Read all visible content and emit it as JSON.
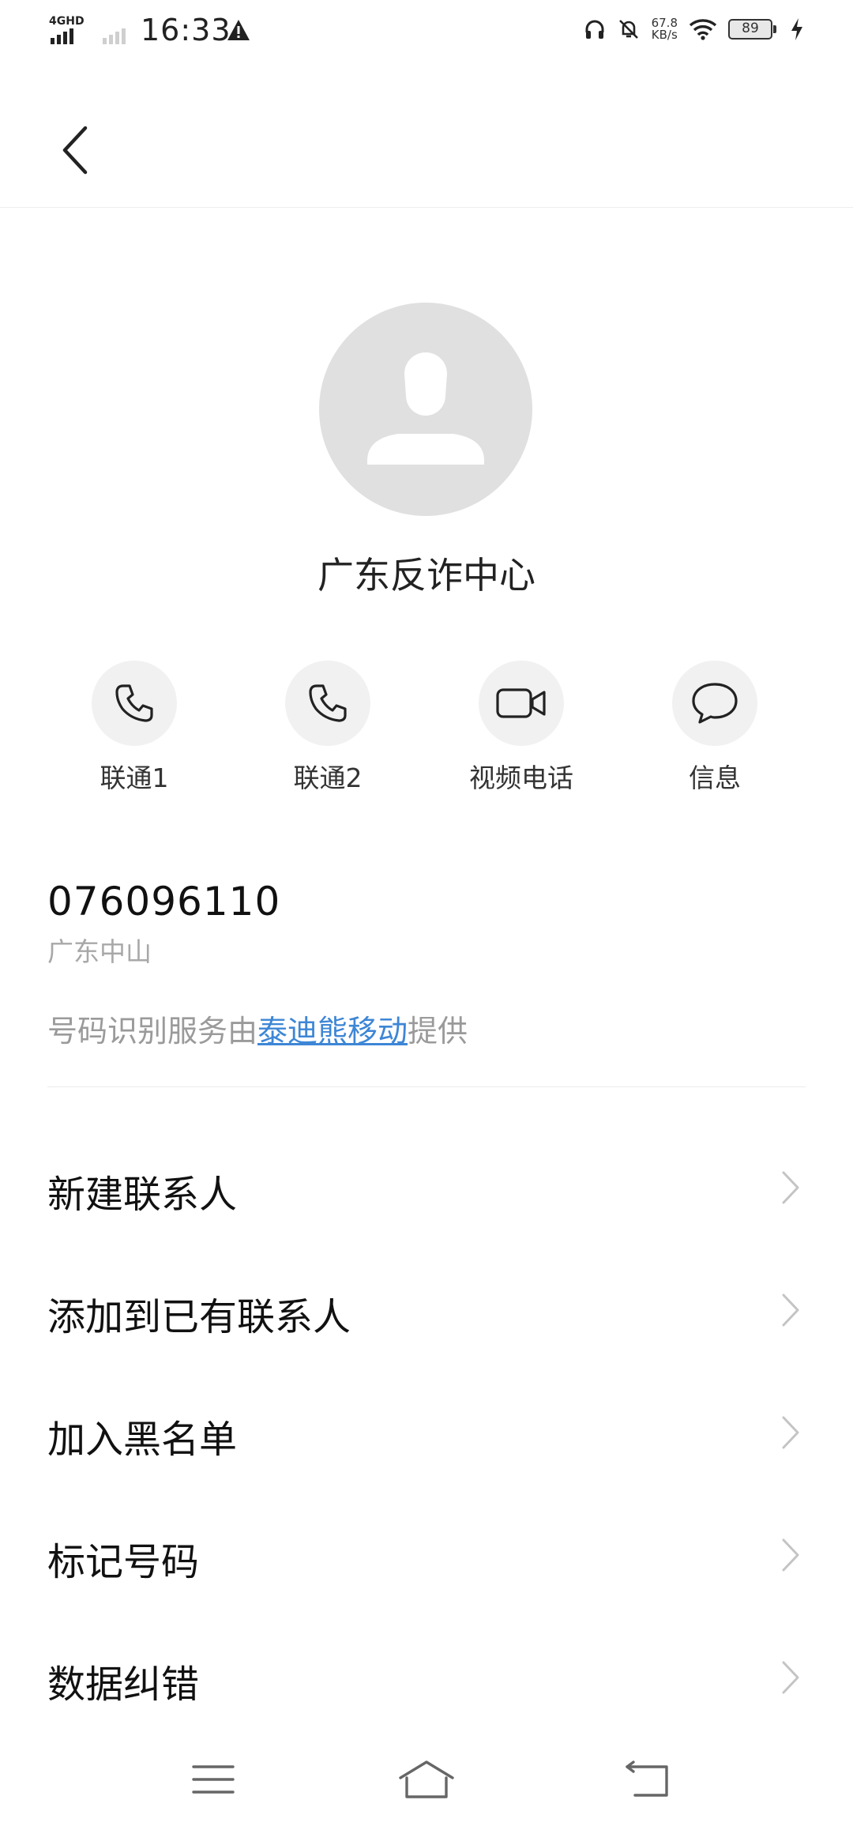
{
  "status_bar": {
    "network": "4GHD",
    "time": "16:33",
    "speed_value": "67.8",
    "speed_unit": "KB/s",
    "battery": "89",
    "icons": [
      "signal-icon",
      "warning-icon",
      "headphones-icon",
      "bell-off-icon",
      "wifi-icon",
      "battery-icon",
      "charging-icon"
    ]
  },
  "header": {
    "back_icon": "back-chevron-icon"
  },
  "contact": {
    "name": "广东反诈中心",
    "number": "076096110",
    "location": "广东中山",
    "provider_prefix": "号码识别服务由",
    "provider_link": "泰迪熊移动",
    "provider_suffix": "提供"
  },
  "actions": [
    {
      "label": "联通1",
      "icon": "phone-icon"
    },
    {
      "label": "联通2",
      "icon": "phone-icon"
    },
    {
      "label": "视频电话",
      "icon": "video-icon"
    },
    {
      "label": "信息",
      "icon": "message-icon"
    }
  ],
  "menu": [
    {
      "label": "新建联系人"
    },
    {
      "label": "添加到已有联系人"
    },
    {
      "label": "加入黑名单"
    },
    {
      "label": "标记号码"
    },
    {
      "label": "数据纠错"
    }
  ],
  "nav_bar": {
    "icons": [
      "menu-icon",
      "home-icon",
      "back-icon"
    ]
  },
  "colors": {
    "link": "#3d86d6",
    "avatar_bg": "#e0e0e0",
    "action_bg": "#f1f1f1"
  }
}
